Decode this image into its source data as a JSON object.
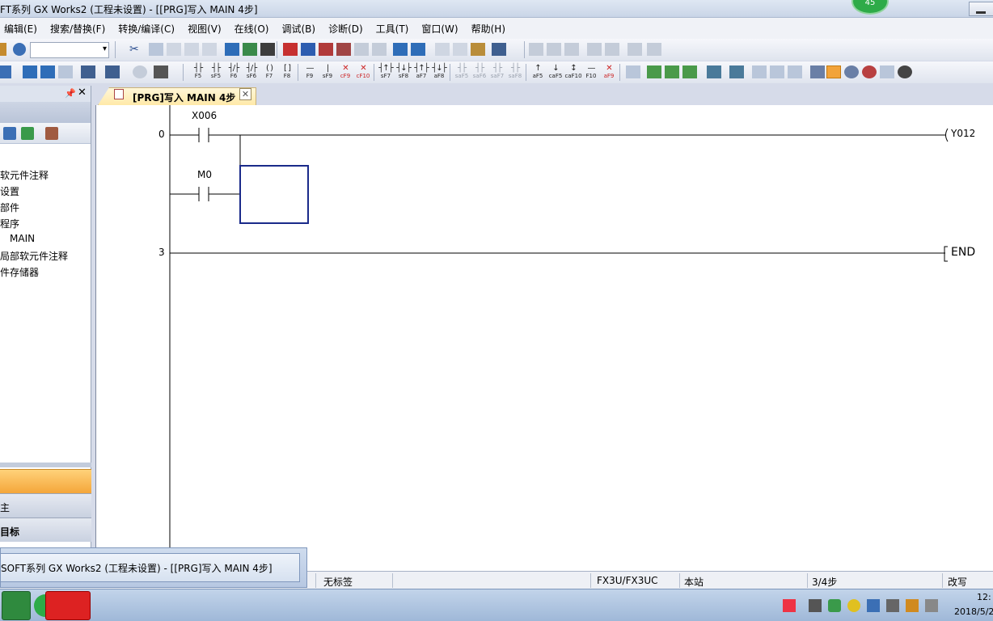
{
  "window": {
    "title": "FT系列 GX Works2 (工程未设置) - [[PRG]写入 MAIN 4步]",
    "badge_count": "45"
  },
  "menubar": [
    "编辑(E)",
    "搜索/替换(F)",
    "转换/编译(C)",
    "视图(V)",
    "在线(O)",
    "调试(B)",
    "诊断(D)",
    "工具(T)",
    "窗口(W)",
    "帮助(H)"
  ],
  "toolbar2_keys": [
    {
      "sym": "┤├",
      "label": "F5"
    },
    {
      "sym": "┤├",
      "label": "sF5"
    },
    {
      "sym": "┤/├",
      "label": "F6"
    },
    {
      "sym": "┤/├",
      "label": "sF6"
    },
    {
      "sym": "( )",
      "label": "F7"
    },
    {
      "sym": "[ ]",
      "label": "F8"
    },
    {
      "sym": "—",
      "label": "F9"
    },
    {
      "sym": "|",
      "label": "sF9"
    },
    {
      "sym": "✕",
      "label": "cF9"
    },
    {
      "sym": "✕",
      "label": "cF10"
    },
    {
      "sym": "┤↑├",
      "label": "sF7"
    },
    {
      "sym": "┤↓├",
      "label": "sF8"
    },
    {
      "sym": "┤↑├",
      "label": "aF7"
    },
    {
      "sym": "┤↓├",
      "label": "aF8"
    },
    {
      "sym": "┤├",
      "label": "saF5"
    },
    {
      "sym": "┤├",
      "label": "saF6"
    },
    {
      "sym": "┤├",
      "label": "saF7"
    },
    {
      "sym": "┤├",
      "label": "saF8"
    },
    {
      "sym": "↑",
      "label": "aF5"
    },
    {
      "sym": "↓",
      "label": "caF5"
    },
    {
      "sym": "↕",
      "label": "caF10"
    },
    {
      "sym": "—",
      "label": "F10"
    },
    {
      "sym": "✕",
      "label": "aF9"
    }
  ],
  "left_panel": {
    "tree": [
      "软元件注释",
      "设置",
      "部件",
      "程序",
      "MAIN",
      "局部软元件注释",
      "件存储器"
    ],
    "nav_1": "主",
    "nav_2": "目标"
  },
  "tab": {
    "label": "[PRG]写入 MAIN 4步",
    "close": "✕"
  },
  "ladder": {
    "rungs": [
      {
        "step": "0",
        "contacts": [
          "X006",
          "M0"
        ],
        "coil": "Y012"
      },
      {
        "step": "3",
        "instruction": "END"
      }
    ]
  },
  "statusbar": {
    "label": "无标签",
    "plc_type": "FX3U/FX3UC",
    "station": "本站",
    "steps": "3/4步",
    "mode": "改写"
  },
  "taskbar": {
    "popup_title": "SOFT系列 GX Works2 (工程未设置) - [[PRG]写入 MAIN 4步]",
    "clock_time": "12:",
    "clock_date": "2018/5/2"
  }
}
